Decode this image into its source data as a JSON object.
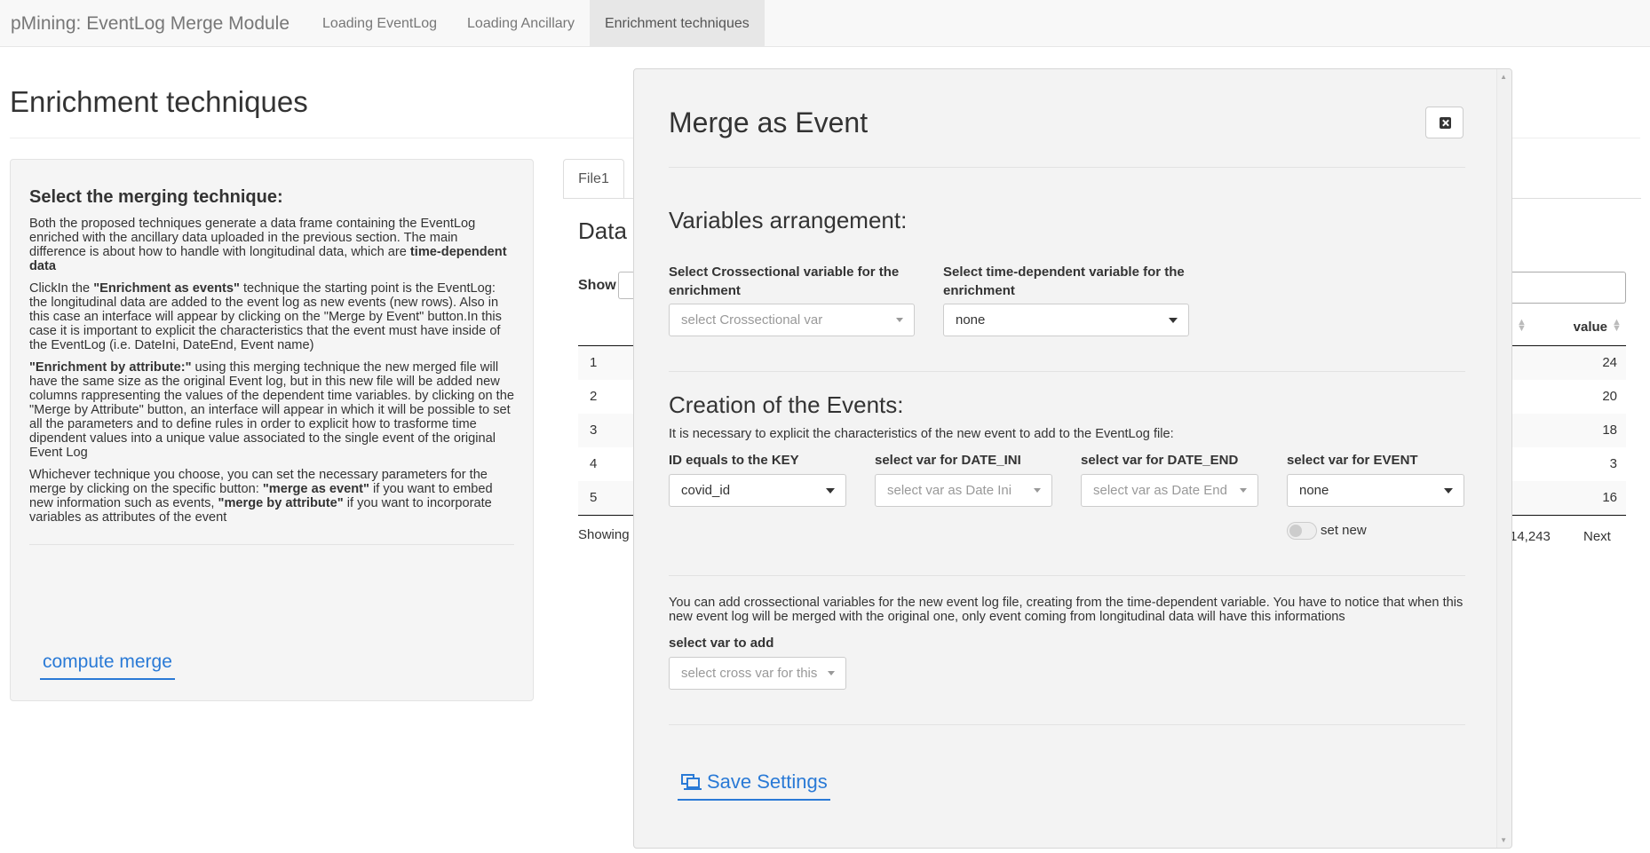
{
  "navbar": {
    "brand": "pMining: EventLog Merge Module",
    "tabs": [
      {
        "label": "Loading EventLog"
      },
      {
        "label": "Loading Ancillary"
      },
      {
        "label": "Enrichment techniques"
      }
    ]
  },
  "page": {
    "title": "Enrichment techniques"
  },
  "sidebar": {
    "heading": "Select the merging technique:",
    "p1_text": "Both the proposed techniques generate a data frame containing the EventLog enriched with the ancillary data uploaded in the previous section. The main difference is about how to handle with longitudinal data, which are ",
    "p1_bold": "time-dependent data",
    "p2_pre": "ClickIn the ",
    "p2_bold": "\"Enrichment as events\"",
    "p2_text": " technique the starting point is the EventLog: the longitudinal data are added to the event log as new events (new rows). Also in this case an interface will appear by clicking on the \"Merge by Event\" button.In this case it is important to explicit the characteristics that the event must have inside of the EventLog (i.e. DateIni, DateEnd, Event name)",
    "p3_bold": "\"Enrichment by attribute:\"",
    "p3_text": " using this merging technique the new merged file will have the same size as the original Event log, but in this new file will be added new columns rappresenting the values of the dependent time variables. by clicking on the \"Merge by Attribute\" button, an interface will appear in which it will be possible to set all the parameters and to define rules in order to explicit how to trasforme time dipendent values into a unique value associated to the single event of the original Event Log",
    "p4_text": "Whichever technique you choose, you can set the necessary parameters for the merge by clicking on the specific button: ",
    "p4_bold1": "\"merge as event\"",
    "p4_mid": " if you want to embed new information such as events, ",
    "p4_bold2": "\"merge by attribute\"",
    "p4_end": " if you want to incorporate variables as attributes of the event",
    "compute_label": "compute merge"
  },
  "main": {
    "tab_label": "File1",
    "data_heading": "Data",
    "show_label": "Show",
    "value_header": "value",
    "rows": [
      {
        "index": "1",
        "value": "24"
      },
      {
        "index": "2",
        "value": "20"
      },
      {
        "index": "3",
        "value": "18"
      },
      {
        "index": "4",
        "value": "3"
      },
      {
        "index": "5",
        "value": "16"
      }
    ],
    "showing_label": "Showing",
    "count_partial": "14,243",
    "next_label": "Next"
  },
  "modal": {
    "title": "Merge as Event",
    "variables_heading": "Variables arrangement:",
    "cross_label": "Select Crossectional variable for the enrichment",
    "cross_placeholder": "select Crossectional var",
    "time_label": "Select time-dependent variable for the enrichment",
    "time_value": "none",
    "events_heading": "Creation of the Events:",
    "events_help": "It is necessary to explicit the characteristics of the new event to add to the EventLog file:",
    "id_label": "ID equals to the KEY",
    "id_value": "covid_id",
    "date_ini_label": "select var for DATE_INI",
    "date_ini_placeholder": "select var as Date Ini",
    "date_end_label": "select var for DATE_END",
    "date_end_placeholder": "select var as Date End",
    "event_label": "select var for EVENT",
    "event_value": "none",
    "set_new_label": "set new",
    "cross_help": "You can add crossectional variables for the new event log file, creating from the time-dependent variable. You have to notice that when this new event log will be merged with the original one, only event coming from longitudinal data will have this informations",
    "add_label": "select var to add",
    "add_placeholder": "select cross var for this",
    "save_label": "Save Settings"
  },
  "colors": {
    "link_blue": "#2a7ad6",
    "navbar_bg": "#f8f8f8",
    "panel_bg": "#f5f5f5",
    "modal_bg": "#f3f3f3"
  },
  "icons": [
    "close-icon",
    "save-settings-icon",
    "chevron-down-icon",
    "sort-icon"
  ]
}
